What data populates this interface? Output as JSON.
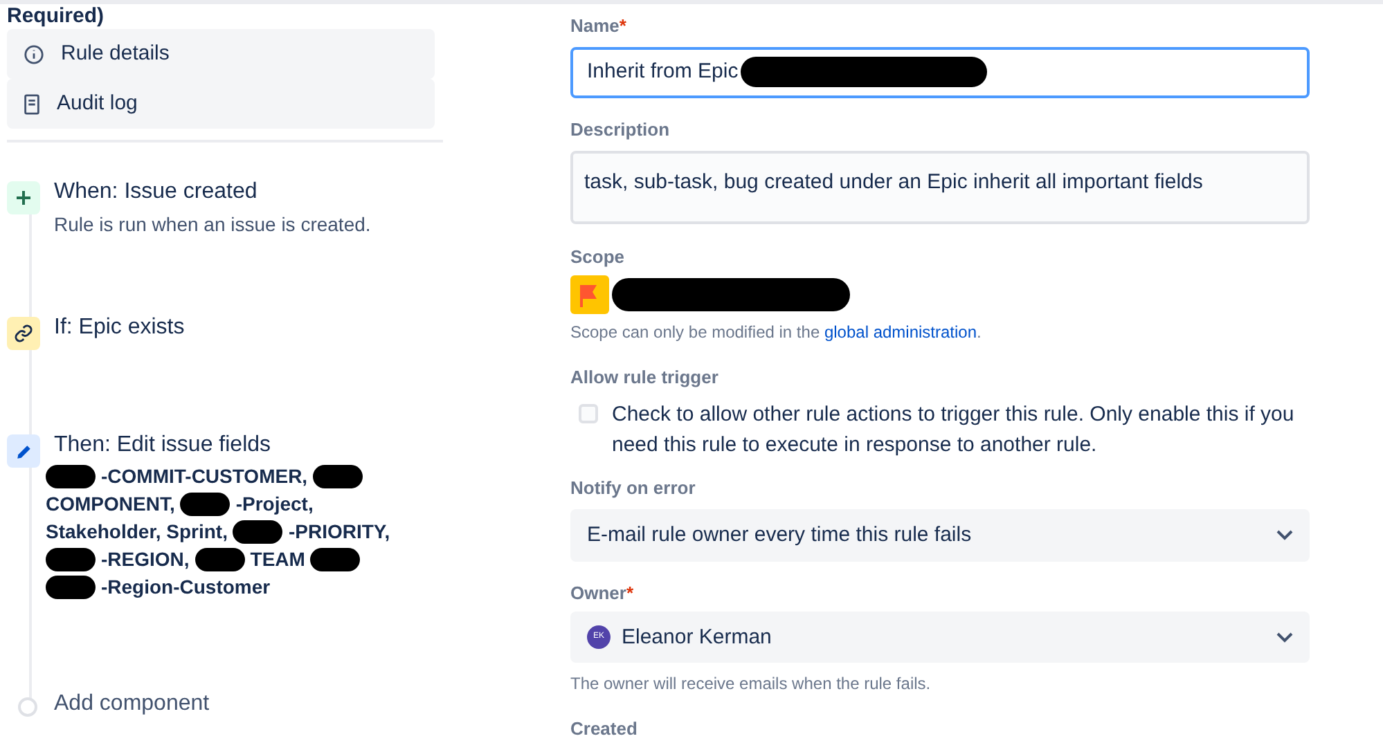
{
  "sidebar": {
    "heading": "Required)",
    "items": [
      {
        "kind": "info",
        "label": "Rule details"
      },
      {
        "kind": "log",
        "label": "Audit log"
      }
    ]
  },
  "steps": [
    {
      "kind": "trigger",
      "title": "When: Issue created",
      "detail": "Rule is run when an issue is created."
    },
    {
      "kind": "condition",
      "title": "If: Epic exists"
    },
    {
      "kind": "action",
      "title": "Then: Edit issue fields",
      "field_lines": [
        [
          {
            "kind": "redaction"
          },
          {
            "kind": "text",
            "text": "-COMMIT-CUSTOMER,"
          },
          {
            "kind": "redaction"
          }
        ],
        [
          {
            "kind": "text",
            "text": "COMPONENT,"
          },
          {
            "kind": "redaction"
          },
          {
            "kind": "text",
            "text": "-Project,"
          }
        ],
        [
          {
            "kind": "text",
            "text": "Stakeholder, Sprint,"
          },
          {
            "kind": "redaction"
          },
          {
            "kind": "text",
            "text": "-PRIORITY,"
          }
        ],
        [
          {
            "kind": "redaction"
          },
          {
            "kind": "text",
            "text": "-REGION,"
          },
          {
            "kind": "redaction"
          },
          {
            "kind": "text",
            "text": "TEAM"
          },
          {
            "kind": "redaction"
          }
        ],
        [
          {
            "kind": "redaction"
          },
          {
            "kind": "text",
            "text": "-Region-Customer"
          }
        ]
      ]
    },
    {
      "kind": "add",
      "title": "Add component"
    }
  ],
  "form": {
    "name": {
      "label": "Name",
      "required_mark": "*",
      "value": "Inherit from Epic",
      "redacted": true
    },
    "description": {
      "label": "Description",
      "value": "task, sub-task, bug created under an Epic inherit all important fields"
    },
    "scope": {
      "label": "Scope",
      "redacted": true,
      "note": "Scope can only be modified in the",
      "link": "global administration",
      "note_end": "."
    },
    "allow_trigger": {
      "label": "Allow rule trigger",
      "checked": false,
      "text": "Check to allow other rule actions to trigger this rule. Only enable this if you need this rule to execute in response to another rule."
    },
    "notify": {
      "label": "Notify on error",
      "value": "E-mail rule owner every time this rule fails"
    },
    "owner": {
      "label": "Owner",
      "required_mark": "*",
      "initials": "EK",
      "value": "Eleanor Kerman",
      "help": "The owner will receive emails when the rule fails."
    },
    "created": {
      "label": "Created"
    }
  }
}
